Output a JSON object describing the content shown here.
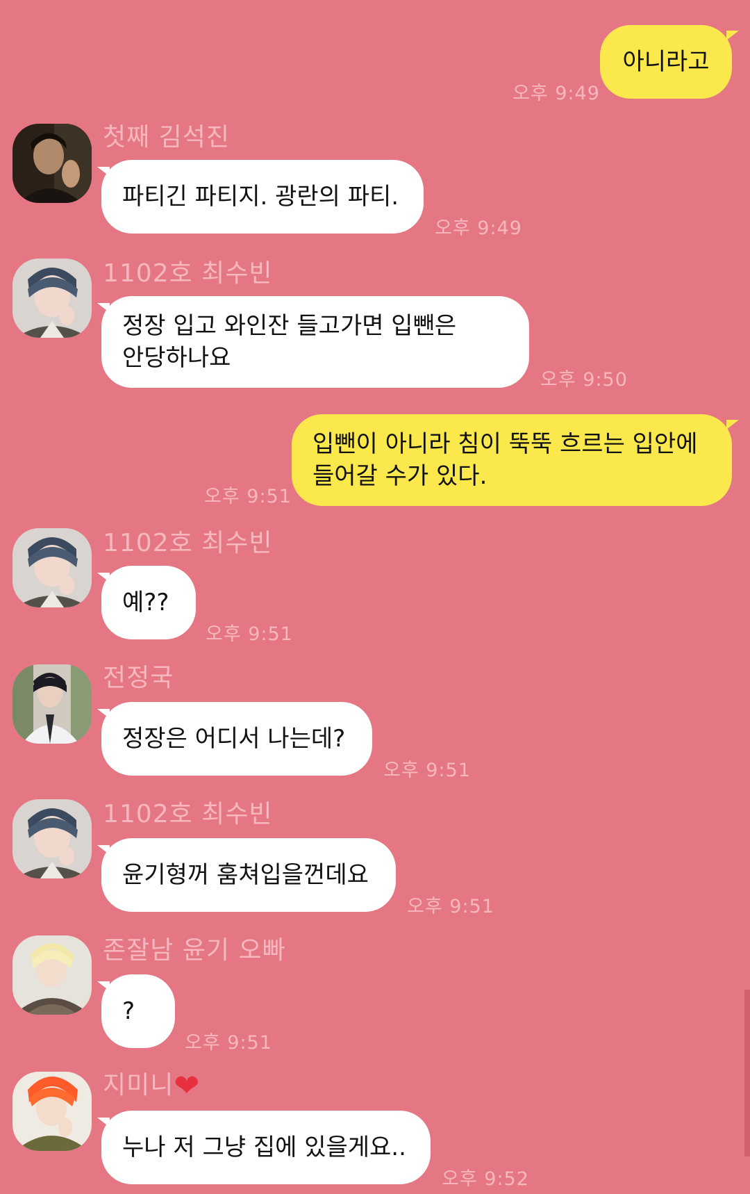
{
  "messages": [
    {
      "type": "out",
      "text": "아니라고",
      "time": "오후 9:49"
    },
    {
      "type": "in",
      "sender": "첫째 김석진",
      "avatar": "avatar-seokjin",
      "text": "파티긴 파티지. 광란의 파티.",
      "time": "오후 9:49"
    },
    {
      "type": "in",
      "sender": "1102호 최수빈",
      "avatar": "avatar-soobin",
      "text_line1": "정장 입고 와인잔 들고가면 입뺀은",
      "text_line2": "안당하나요",
      "time": "오후 9:50"
    },
    {
      "type": "out",
      "text_line1": "입뺀이 아니라 침이 뚝뚝 흐르는 입안에",
      "text_line2": "들어갈 수가 있다.",
      "time": "오후 9:51"
    },
    {
      "type": "in",
      "sender": "1102호 최수빈",
      "avatar": "avatar-soobin",
      "text": "예??",
      "time": "오후 9:51"
    },
    {
      "type": "in",
      "sender": "전정국",
      "avatar": "avatar-jungkook",
      "text": "정장은 어디서 나는데?",
      "time": "오후 9:51"
    },
    {
      "type": "in",
      "sender": "1102호 최수빈",
      "avatar": "avatar-soobin",
      "text": "윤기형꺼 훔쳐입을껀데요",
      "time": "오후 9:51"
    },
    {
      "type": "in",
      "sender": "존잘남 윤기 오빠",
      "avatar": "avatar-yoongi",
      "text": "?",
      "time": "오후 9:51"
    },
    {
      "type": "in",
      "sender": "지미니",
      "avatar": "avatar-jimin",
      "text": "누나 저 그냥 집에 있을게요..",
      "time": "오후 9:52"
    }
  ],
  "colors": {
    "background": "#e57784",
    "incoming_bubble": "#ffffff",
    "outgoing_bubble": "#fbe84c",
    "meta_text": "#f6b7bf",
    "heart": "#e8303e"
  },
  "icons": {
    "heart": "heart-icon"
  }
}
